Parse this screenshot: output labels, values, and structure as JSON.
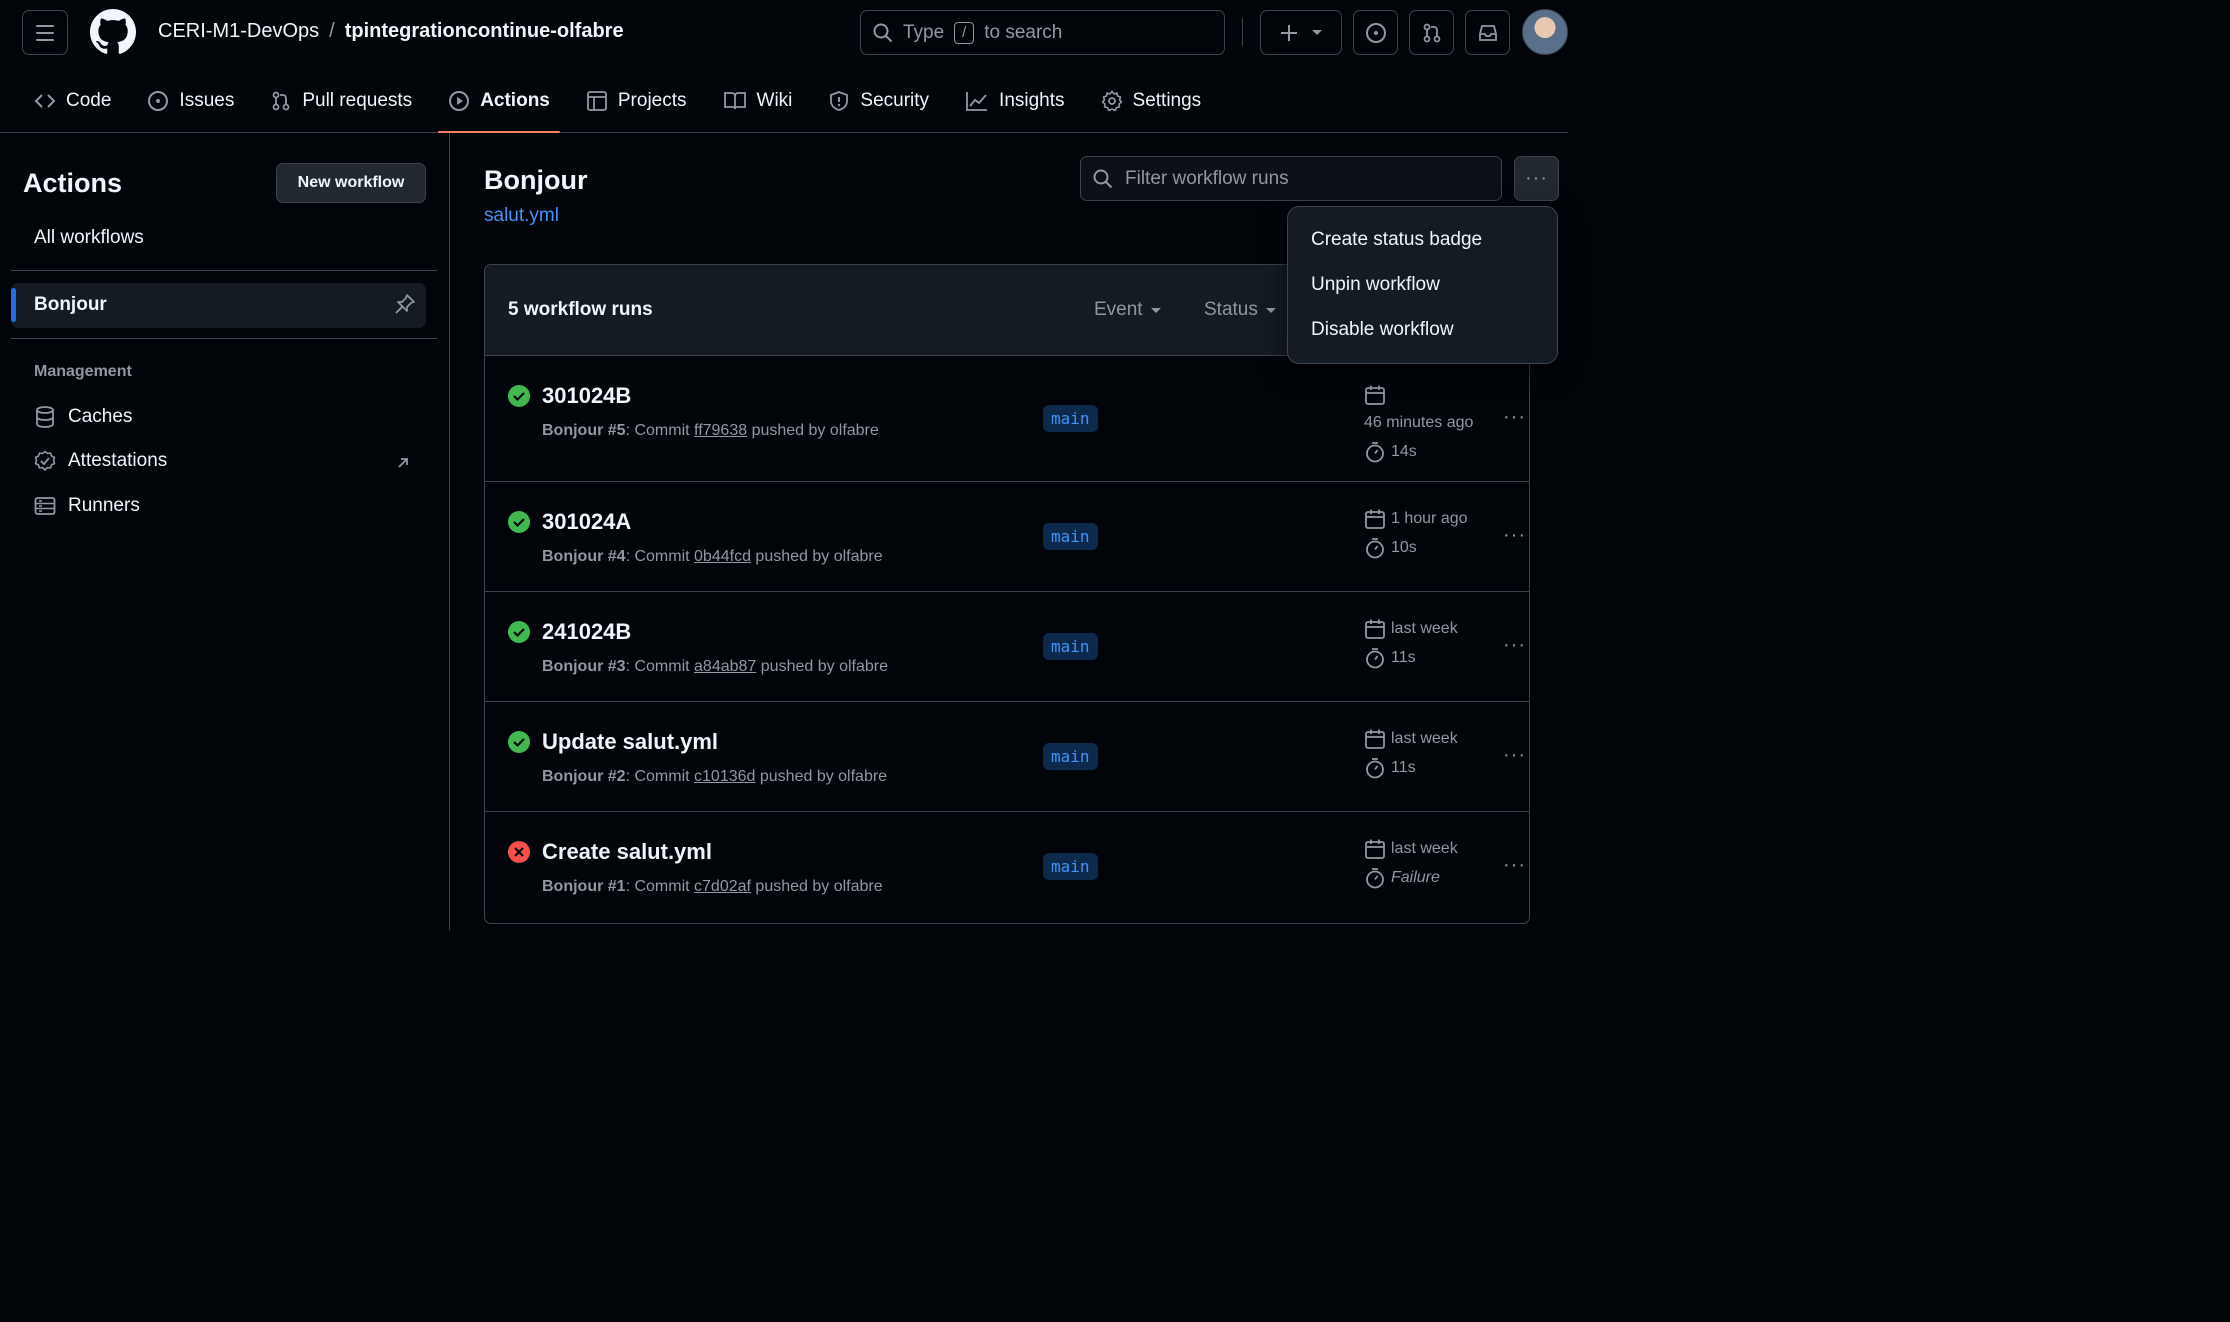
{
  "header": {
    "owner": "CERI-M1-DevOps",
    "separator": "/",
    "repo": "tpintegrationcontinue-olfabre",
    "search": {
      "prefix": "Type",
      "key": "/",
      "suffix": "to search"
    }
  },
  "tabs": [
    {
      "label": "Code",
      "icon": "code-icon"
    },
    {
      "label": "Issues",
      "icon": "issue-opened-icon"
    },
    {
      "label": "Pull requests",
      "icon": "git-pull-request-icon"
    },
    {
      "label": "Actions",
      "icon": "play-icon",
      "active": true
    },
    {
      "label": "Projects",
      "icon": "table-icon"
    },
    {
      "label": "Wiki",
      "icon": "book-icon"
    },
    {
      "label": "Security",
      "icon": "shield-icon"
    },
    {
      "label": "Insights",
      "icon": "graph-icon"
    },
    {
      "label": "Settings",
      "icon": "gear-icon"
    }
  ],
  "sidebar": {
    "title": "Actions",
    "new_workflow": "New workflow",
    "all_workflows": "All workflows",
    "active_workflow": "Bonjour",
    "management_heading": "Management",
    "items": [
      {
        "label": "Caches",
        "icon": "database-icon"
      },
      {
        "label": "Attestations",
        "icon": "verified-icon"
      },
      {
        "label": "Runners",
        "icon": "server-icon"
      }
    ]
  },
  "main": {
    "title": "Bonjour",
    "file": "salut.yml",
    "filter_placeholder": "Filter workflow runs",
    "more": "···",
    "runs_count": "5 workflow runs",
    "filters": {
      "event": "Event",
      "status": "Status"
    }
  },
  "menu": {
    "items": [
      "Create status badge",
      "Unpin workflow",
      "Disable workflow"
    ]
  },
  "runs": [
    {
      "title": "301024B",
      "workflow": "Bonjour",
      "number": "#5",
      "commit_prefix": ": Commit",
      "sha": "ff79638",
      "pushed": "pushed by olfabre",
      "branch": "main",
      "when": "46 minutes ago",
      "duration": "14s",
      "status": "success"
    },
    {
      "title": "301024A",
      "workflow": "Bonjour",
      "number": "#4",
      "commit_prefix": ": Commit",
      "sha": "0b44fcd",
      "pushed": "pushed by olfabre",
      "branch": "main",
      "when": "1 hour ago",
      "duration": "10s",
      "status": "success"
    },
    {
      "title": "241024B",
      "workflow": "Bonjour",
      "number": "#3",
      "commit_prefix": ": Commit",
      "sha": "a84ab87",
      "pushed": "pushed by olfabre",
      "branch": "main",
      "when": "last week",
      "duration": "11s",
      "status": "success"
    },
    {
      "title": "Update salut.yml",
      "workflow": "Bonjour",
      "number": "#2",
      "commit_prefix": ": Commit",
      "sha": "c10136d",
      "pushed": "pushed by olfabre",
      "branch": "main",
      "when": "last week",
      "duration": "11s",
      "status": "success"
    },
    {
      "title": "Create salut.yml",
      "workflow": "Bonjour",
      "number": "#1",
      "commit_prefix": ": Commit",
      "sha": "c7d02af",
      "pushed": "pushed by olfabre",
      "branch": "main",
      "when": "last week",
      "duration": "Failure",
      "status": "failure"
    }
  ],
  "colors": {
    "success": "#3fb950",
    "failure": "#f85149",
    "accent": "#4493f8",
    "tab_underline": "#f78166"
  }
}
